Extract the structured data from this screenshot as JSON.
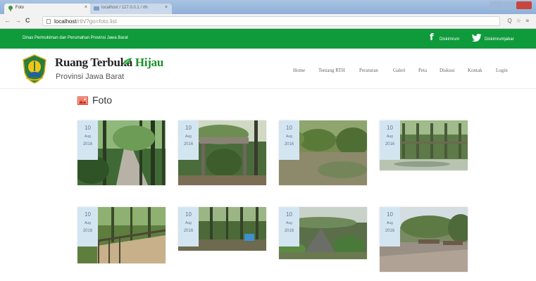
{
  "browser": {
    "active_tab_title": "Foto",
    "inactive_tab_title": "localhost / 127.0.0.1 / rth",
    "close_glyph": "×",
    "url_host": "localhost",
    "url_path": "/rth/?go=foto.list",
    "tool_glyphs": "Q ☆ ≡"
  },
  "topbar": {
    "agency": "Dinas Permukiman dan Perumahan Provinsi Jawa Barat",
    "facebook_glyph": "f",
    "facebook_label": "Diskimrum",
    "twitter_label": "Diskimrumjabar",
    "background": "#0f9a3c"
  },
  "brand": {
    "title_main": "Ruang Terbuka ",
    "title_accent": "Hijau",
    "subtitle": "Provinsi Jawa Barat"
  },
  "nav": [
    "Home",
    "Tentang RTH",
    "Peraturan",
    "Galeri",
    "Peta",
    "Diskusi",
    "Kontak",
    "Login"
  ],
  "page": {
    "title": "Foto",
    "icon": "photo-icon"
  },
  "gallery": [
    {
      "day": "10",
      "month": "Aug",
      "year": "2016",
      "scene": "forest-road"
    },
    {
      "day": "10",
      "month": "Aug",
      "year": "2016",
      "scene": "park-gate"
    },
    {
      "day": "10",
      "month": "Aug",
      "year": "2016",
      "scene": "garden-lawn"
    },
    {
      "day": "10",
      "month": "Aug",
      "year": "2016",
      "scene": "fence-pond"
    },
    {
      "day": "10",
      "month": "Aug",
      "year": "2016",
      "scene": "boardwalk"
    },
    {
      "day": "10",
      "month": "Aug",
      "year": "2016",
      "scene": "woodland-sign"
    },
    {
      "day": "10",
      "month": "Aug",
      "year": "2016",
      "scene": "rock-garden"
    },
    {
      "day": "10",
      "month": "Aug",
      "year": "2016",
      "scene": "plaza-seating"
    }
  ]
}
